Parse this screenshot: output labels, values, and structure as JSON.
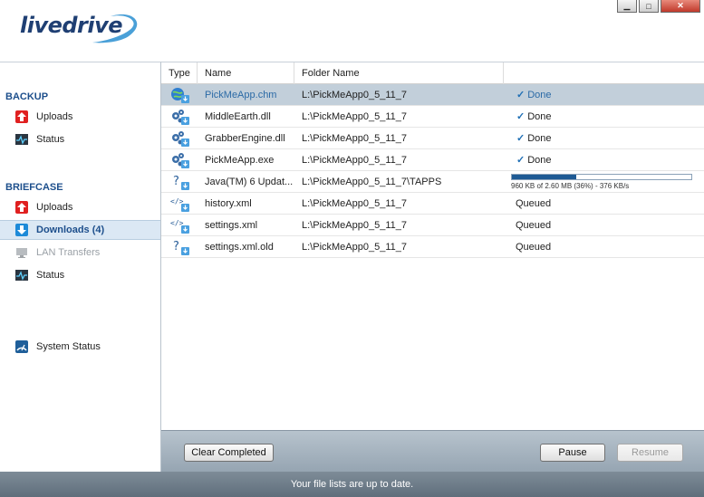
{
  "app": {
    "logo_text_a": "live",
    "logo_text_b": "drive",
    "logo_tm": "TM"
  },
  "window_controls": {
    "minimize": "▁",
    "maximize": "□",
    "close": "✕"
  },
  "sidebar": {
    "backup_title": "BACKUP",
    "backup_items": [
      {
        "label": "Uploads",
        "icon": "upload-red-icon"
      },
      {
        "label": "Status",
        "icon": "pulse-monitor-icon"
      }
    ],
    "briefcase_title": "BRIEFCASE",
    "briefcase_items": [
      {
        "label": "Uploads",
        "icon": "upload-red-icon"
      },
      {
        "label": "Downloads (4)",
        "icon": "download-blue-icon",
        "active": true
      },
      {
        "label": "LAN Transfers",
        "icon": "lan-computer-icon",
        "disabled": true
      },
      {
        "label": "Status",
        "icon": "pulse-monitor-icon"
      }
    ],
    "system_status": {
      "label": "System Status",
      "icon": "gauge-icon"
    }
  },
  "table": {
    "columns": [
      "Type",
      "Name",
      "Folder Name",
      ""
    ],
    "rows": [
      {
        "type": "globe-file-icon",
        "name": "PickMeApp.chm",
        "folder": "L:\\PickMeApp0_5_11_7",
        "status": "Done",
        "done": true,
        "selected": true
      },
      {
        "type": "gears-file-icon",
        "name": "MiddleEarth.dll",
        "folder": "L:\\PickMeApp0_5_11_7",
        "status": "Done",
        "done": true
      },
      {
        "type": "gears-file-icon",
        "name": "GrabberEngine.dll",
        "folder": "L:\\PickMeApp0_5_11_7",
        "status": "Done",
        "done": true
      },
      {
        "type": "gears-file-icon",
        "name": "PickMeApp.exe",
        "folder": "L:\\PickMeApp0_5_11_7",
        "status": "Done",
        "done": true
      },
      {
        "type": "unknown-file-icon",
        "name": "Java(TM) 6 Updat...",
        "folder": "L:\\PickMeApp0_5_11_7\\TAPPS",
        "progress": 0.36,
        "progress_text": "960 KB of 2.60 MB (36%) - 376 KB/s"
      },
      {
        "type": "xml-file-icon",
        "name": "history.xml",
        "folder": "L:\\PickMeApp0_5_11_7",
        "status": "Queued"
      },
      {
        "type": "xml-file-icon",
        "name": "settings.xml",
        "folder": "L:\\PickMeApp0_5_11_7",
        "status": "Queued"
      },
      {
        "type": "unknown-file-icon",
        "name": "settings.xml.old",
        "folder": "L:\\PickMeApp0_5_11_7",
        "status": "Queued"
      }
    ]
  },
  "toolbar": {
    "clear_label": "Clear Completed",
    "pause_label": "Pause",
    "resume_label": "Resume"
  },
  "statusbar": {
    "text": "Your file lists are up to date."
  },
  "colors": {
    "accent": "#1d4f8c",
    "selected_row": "#c2cfda",
    "check": "#1f6fb5",
    "progress": "#1e5a94"
  }
}
